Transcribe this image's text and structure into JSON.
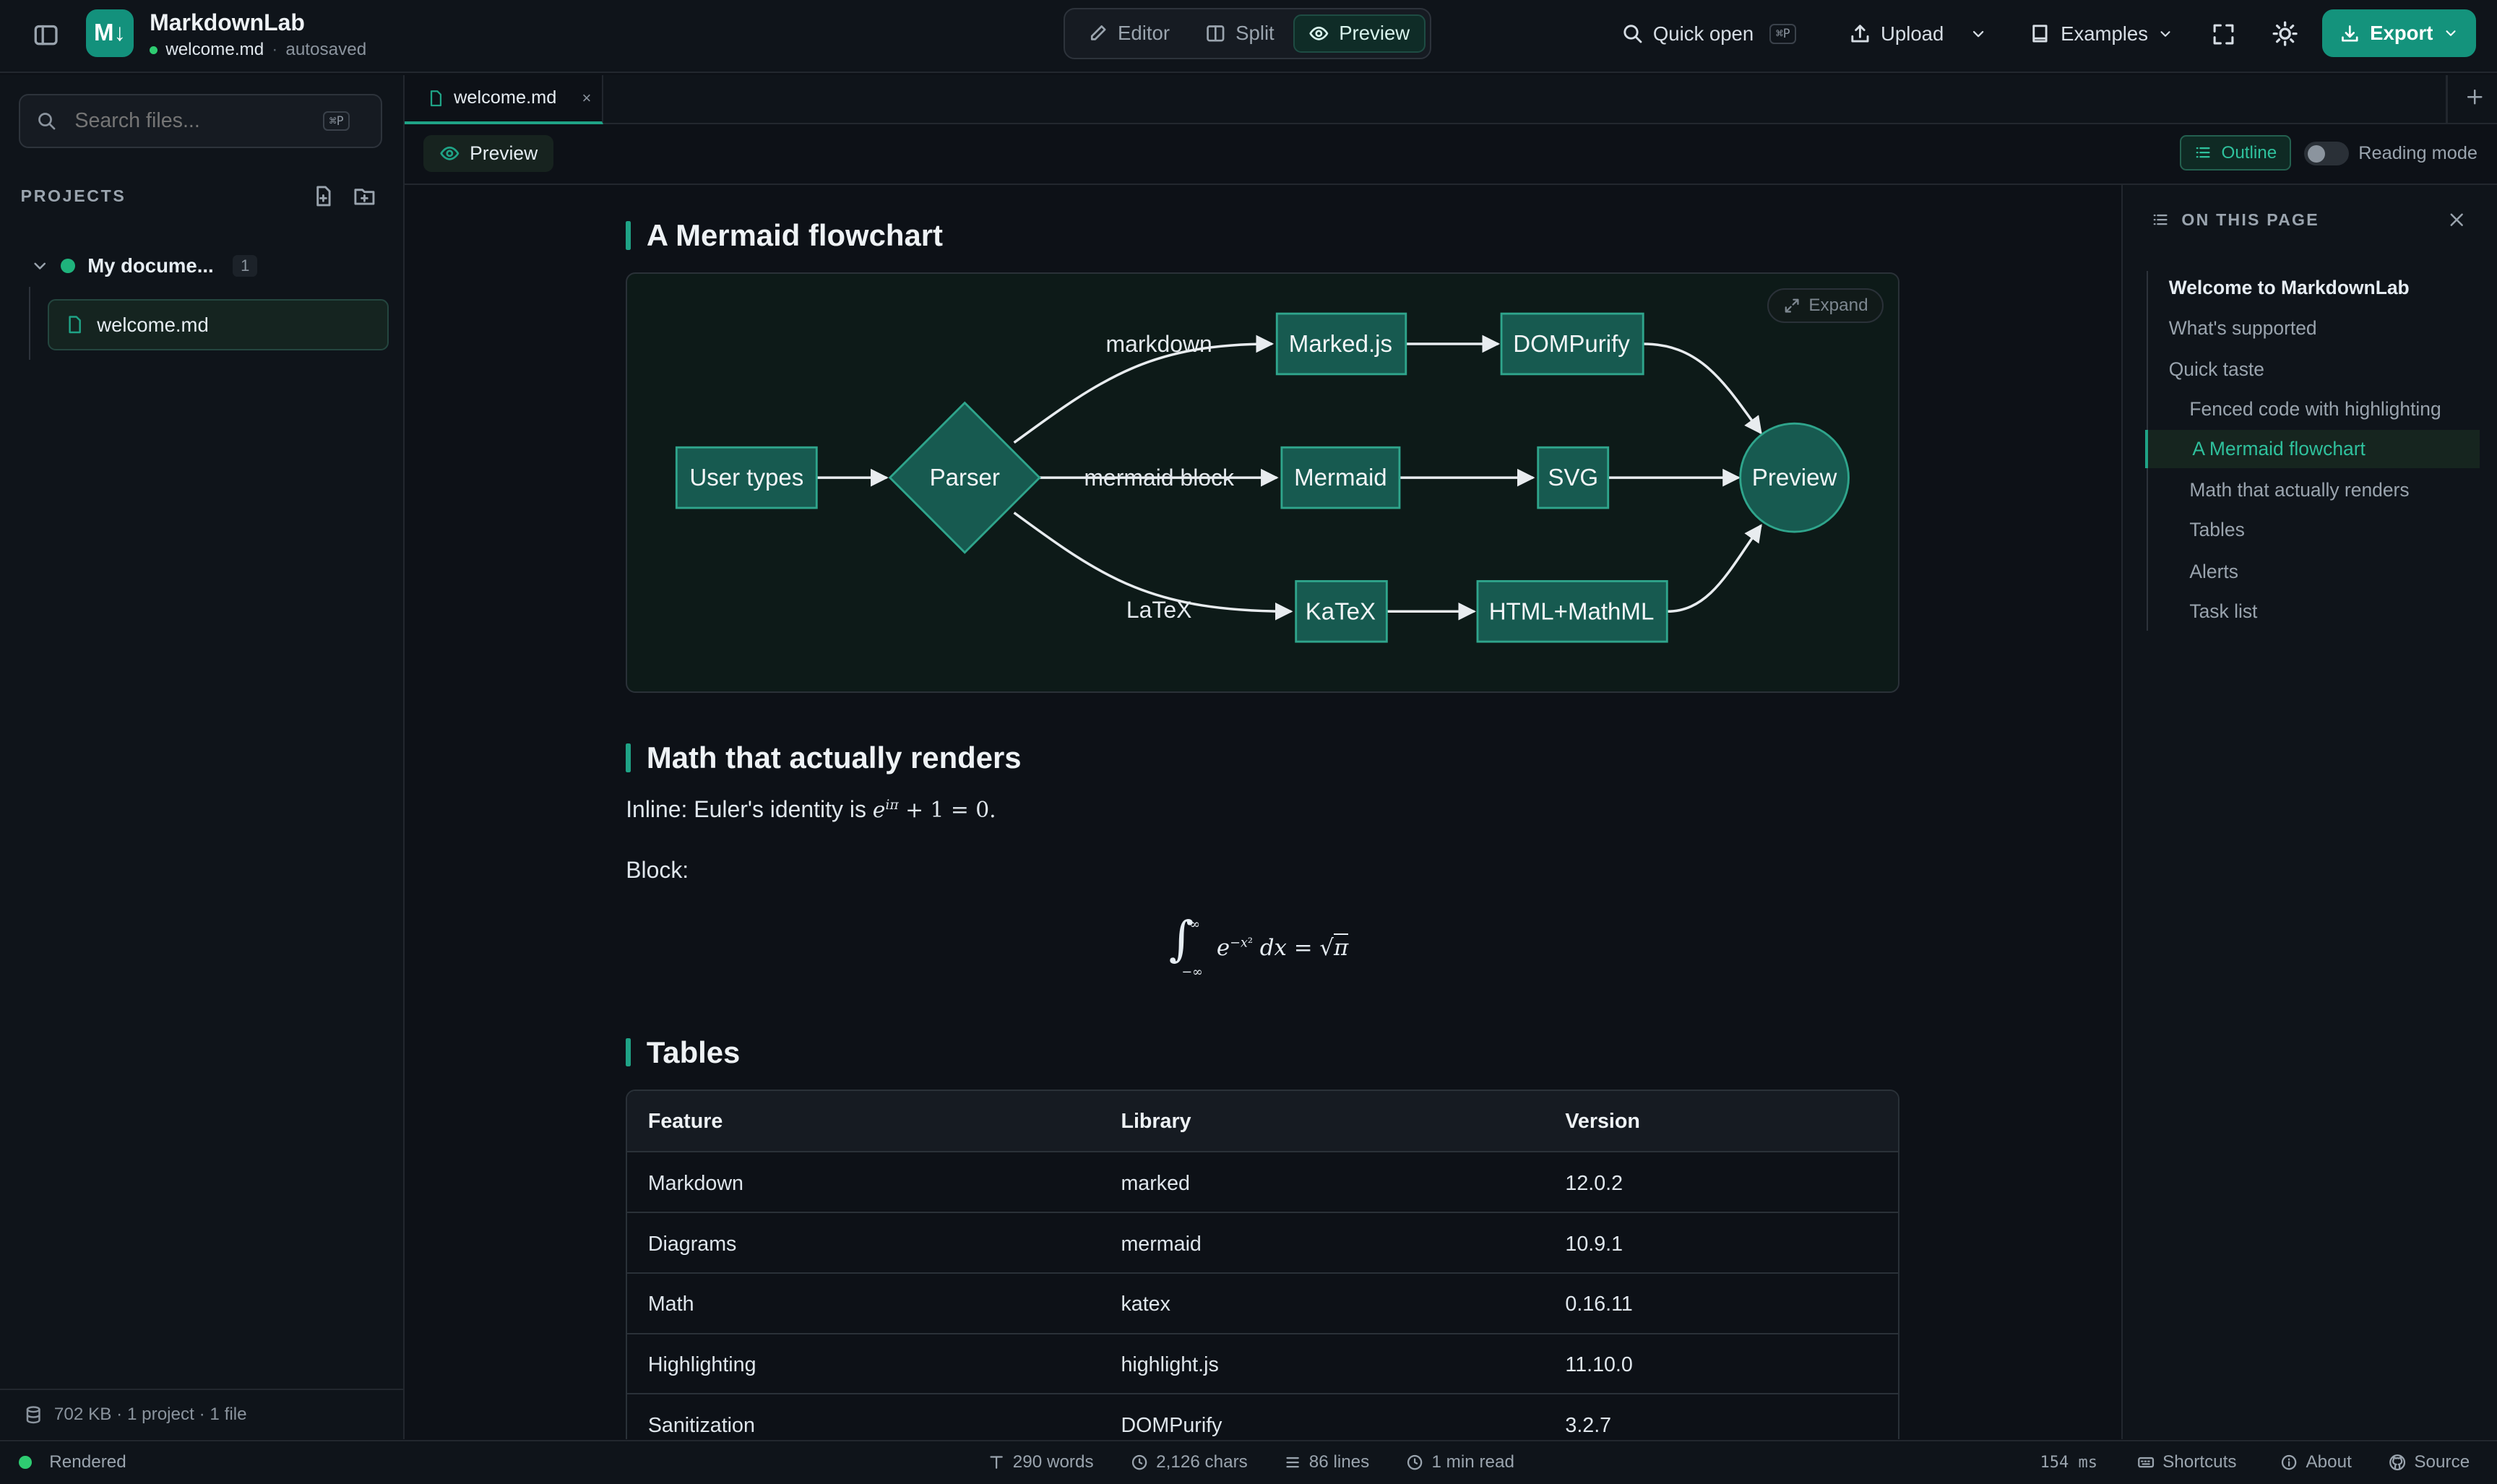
{
  "app": {
    "name": "MarkdownLab",
    "logo_text": "M↓",
    "file": "welcome.md",
    "save_state": "autosaved"
  },
  "view_modes": [
    {
      "label": "Editor"
    },
    {
      "label": "Split"
    },
    {
      "label": "Preview",
      "active": true
    }
  ],
  "toolbar": {
    "quick_open": "Quick open",
    "quick_open_shortcut": "⌘P",
    "upload": "Upload",
    "examples": "Examples",
    "export": "Export"
  },
  "sidebar": {
    "search_placeholder": "Search files...",
    "search_shortcut": "⌘P",
    "projects_heading": "PROJECTS",
    "project": {
      "name": "My docume...",
      "count": "1"
    },
    "files": [
      {
        "name": "welcome.md",
        "selected": true
      }
    ],
    "footer": "702 KB · 1 project · 1 file"
  },
  "tabs": [
    {
      "label": "welcome.md",
      "close": "×"
    }
  ],
  "subbar": {
    "preview_label": "Preview",
    "outline_label": "Outline",
    "reading_mode_label": "Reading mode"
  },
  "content": {
    "flowchart_heading": "A Mermaid flowchart",
    "expand_label": "Expand",
    "flowchart": {
      "nodes": [
        "User types",
        "Parser",
        "Marked.js",
        "DOMPurify",
        "Mermaid",
        "SVG",
        "KaTeX",
        "HTML+MathML",
        "Preview"
      ],
      "edge_labels": [
        "markdown",
        "mermaid block",
        "LaTeX"
      ]
    },
    "math_heading": "Math that actually renders",
    "inline_text": "Inline: Euler's identity is",
    "block_label": "Block:",
    "tables_heading": "Tables",
    "table": {
      "headers": [
        "Feature",
        "Library",
        "Version"
      ],
      "rows": [
        [
          "Markdown",
          "marked",
          "12.0.2"
        ],
        [
          "Diagrams",
          "mermaid",
          "10.9.1"
        ],
        [
          "Math",
          "katex",
          "0.16.11"
        ],
        [
          "Highlighting",
          "highlight.js",
          "11.10.0"
        ],
        [
          "Sanitization",
          "DOMPurify",
          "3.2.7"
        ]
      ]
    }
  },
  "outline": {
    "heading": "ON THIS PAGE",
    "items": [
      {
        "label": "Welcome to MarkdownLab",
        "level": 1
      },
      {
        "label": "What's supported",
        "level": 1
      },
      {
        "label": "Quick taste",
        "level": 1
      },
      {
        "label": "Fenced code with highlighting",
        "level": 2
      },
      {
        "label": "A Mermaid flowchart",
        "level": 2,
        "active": true
      },
      {
        "label": "Math that actually renders",
        "level": 2
      },
      {
        "label": "Tables",
        "level": 2
      },
      {
        "label": "Alerts",
        "level": 2
      },
      {
        "label": "Task list",
        "level": 2
      }
    ]
  },
  "statusbar": {
    "status": "Rendered",
    "words": "290 words",
    "chars": "2,126 chars",
    "lines": "86 lines",
    "read_time": "1 min read",
    "render_time": "154 ms",
    "shortcuts": "Shortcuts",
    "about": "About",
    "source": "Source"
  },
  "colors": {
    "accent": "#1fa386",
    "export_bg": "#14937c",
    "node_fill": "#175a50",
    "status_dot": "#2ecc71"
  }
}
